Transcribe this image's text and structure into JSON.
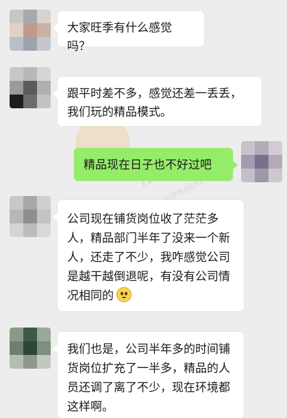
{
  "messages": [
    {
      "side": "left",
      "text": "大家旺季有什么感觉吗？"
    },
    {
      "side": "left",
      "text": "跟平时差不多，感觉还差一丢丢，我们玩的精品模式。"
    },
    {
      "side": "right",
      "text": "精品现在日子也不好过吧"
    },
    {
      "side": "left",
      "text": "公司现在铺货岗位收了茫茫多人，精品部门半年了没来一个新人，还走了不少，我咋感觉公司是越干越倒退呢，有没有公司情况相同的",
      "emoji": "flushed-face-emoji"
    },
    {
      "side": "left",
      "text": "我们也是，公司半年多的时间铺货岗位扩充了一半多，精品的人员还调了离了不少，现在环境都这样啊。"
    }
  ],
  "watermark": {
    "brand_text": "胜",
    "sub_text": "跨境电商ERP",
    "side_text": "32天退款"
  },
  "colors": {
    "background": "#ededed",
    "incoming_bubble": "#ffffff",
    "outgoing_bubble": "#95ec69"
  }
}
